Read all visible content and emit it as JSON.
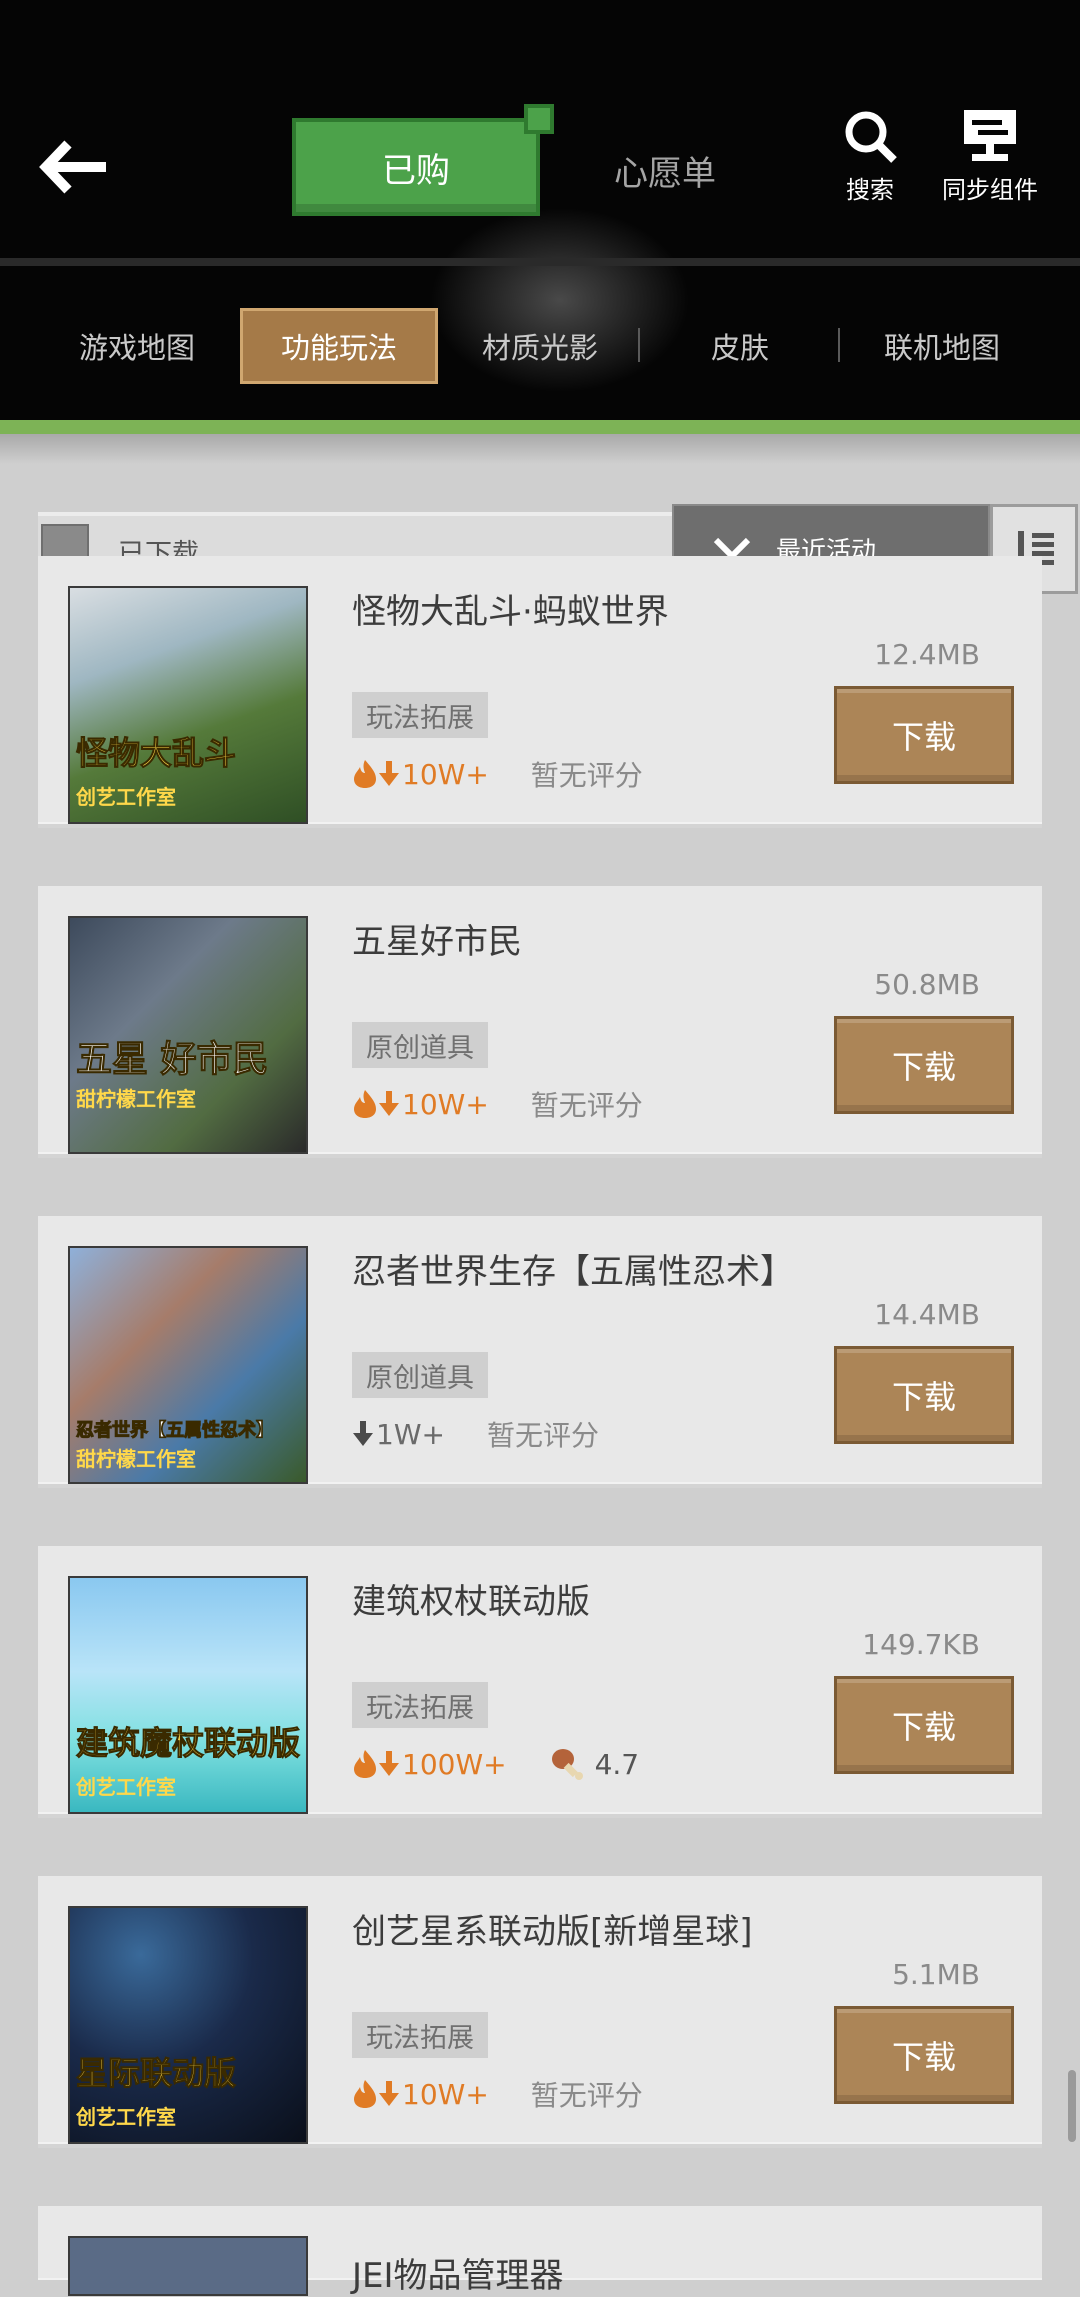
{
  "header": {
    "tabs": {
      "purchased": "已购",
      "wishlist": "心愿单"
    },
    "tools": {
      "search": "搜索",
      "sync": "同步组件"
    }
  },
  "categories": [
    "游戏地图",
    "功能玩法",
    "材质光影",
    "皮肤",
    "联机地图"
  ],
  "active_category": "功能玩法",
  "filter": {
    "downloaded_label": "已下载",
    "sort_label": "最近活动"
  },
  "items": [
    {
      "title": "怪物大乱斗·蚂蚁世界",
      "size": "12.4MB",
      "tag": "玩法拓展",
      "downloads": "10W+",
      "rating": "暂无评分",
      "cap1": "怪物大乱斗",
      "cap2": "创艺工作室",
      "hot": true
    },
    {
      "title": "五星好市民",
      "size": "50.8MB",
      "tag": "原创道具",
      "downloads": "10W+",
      "rating": "暂无评分",
      "cap1": "五星 好市民",
      "cap2": "甜柠檬工作室",
      "hot": true
    },
    {
      "title": "忍者世界生存【五属性忍术】",
      "size": "14.4MB",
      "tag": "原创道具",
      "downloads": "1W+",
      "rating": "暂无评分",
      "cap1": "忍者世界【五属性忍术】",
      "cap2": "甜柠檬工作室",
      "hot": false
    },
    {
      "title": "建筑权杖联动版",
      "size": "149.7KB",
      "tag": "玩法拓展",
      "downloads": "100W+",
      "rating": "4.7",
      "cap1": "建筑魔杖联动版",
      "cap2": "创艺工作室",
      "hot": true
    },
    {
      "title": "创艺星系联动版[新增星球]",
      "size": "5.1MB",
      "tag": "玩法拓展",
      "downloads": "10W+",
      "rating": "暂无评分",
      "cap1": "星际联动版",
      "cap2": "创艺工作室",
      "hot": true
    },
    {
      "title": "JEI物品管理器"
    }
  ],
  "download_button": "下载",
  "colors": {
    "accent_green": "#4ca24a",
    "brown_button": "#ac8557",
    "fire": "#e07b25"
  }
}
